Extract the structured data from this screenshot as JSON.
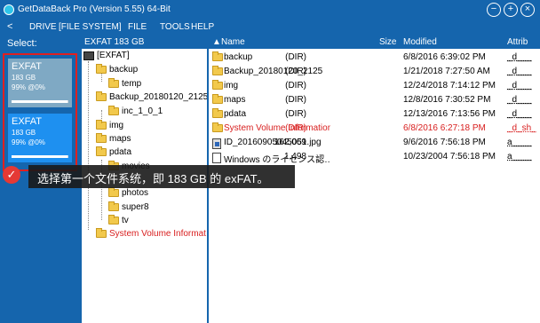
{
  "titlebar": {
    "title": "GetDataBack Pro (Version 5.55) 64-Bit",
    "btn_minimize": "−",
    "btn_maximize": "+",
    "btn_close": "×"
  },
  "menu": {
    "back": "<",
    "items": [
      "DRIVE",
      "[FILE SYSTEM]",
      "FILE",
      "TOOLS",
      "HELP"
    ]
  },
  "sidebar": {
    "select_label": "Select:",
    "drives": [
      {
        "name": "EXFAT",
        "size": "183 GB",
        "pct": "99% @0%",
        "fill": 0.99
      },
      {
        "name": "EXFAT",
        "size": "183 GB",
        "pct": "99% @0%",
        "fill": 0.99
      }
    ]
  },
  "tree": {
    "header": "EXFAT 183 GB",
    "items": [
      {
        "label": "[EXFAT]",
        "icon": "drive-icon",
        "red": false
      },
      {
        "label": "backup",
        "icon": "folder-icon",
        "red": false
      },
      {
        "label": "temp",
        "icon": "folder-icon",
        "red": false
      },
      {
        "label": "Backup_20180120_2125",
        "icon": "folder-icon",
        "red": false
      },
      {
        "label": "inc_1_0_1",
        "icon": "folder-icon",
        "red": false
      },
      {
        "label": "img",
        "icon": "folder-icon",
        "red": false
      },
      {
        "label": "maps",
        "icon": "folder-icon",
        "red": false
      },
      {
        "label": "pdata",
        "icon": "folder-icon",
        "red": false
      },
      {
        "label": "movies",
        "icon": "folder-icon",
        "red": false
      },
      {
        "label": "photos",
        "icon": "folder-icon",
        "red": false
      },
      {
        "label": "super8",
        "icon": "folder-icon",
        "red": false
      },
      {
        "label": "tv",
        "icon": "folder-icon",
        "red": false
      },
      {
        "label": "System Volume Informat",
        "icon": "folder-icon",
        "red": true
      }
    ]
  },
  "list": {
    "columns": {
      "name": "Name",
      "sort_glyph": "▲",
      "size": "Size",
      "modified": "Modified",
      "attrib": "Attrib"
    },
    "rows": [
      {
        "name": "backup",
        "size": "(DIR)",
        "modified": "6/8/2016 6:39:02 PM",
        "attrib": "_d___",
        "icon": "folder-icon",
        "red": false
      },
      {
        "name": "Backup_20180120_2125",
        "size": "(DIR)",
        "modified": "1/21/2018 7:27:50 AM",
        "attrib": "_d___",
        "icon": "folder-icon",
        "red": false
      },
      {
        "name": "img",
        "size": "(DIR)",
        "modified": "12/24/2018 7:14:12 PM",
        "attrib": "_d___",
        "icon": "folder-icon",
        "red": false
      },
      {
        "name": "maps",
        "size": "(DIR)",
        "modified": "12/8/2016 7:30:52 PM",
        "attrib": "_d___",
        "icon": "folder-icon",
        "red": false
      },
      {
        "name": "pdata",
        "size": "(DIR)",
        "modified": "12/13/2016 7:13:56 PM",
        "attrib": "_d___",
        "icon": "folder-icon",
        "red": false
      },
      {
        "name": "System Volume Information",
        "size": "(DIR)",
        "modified": "6/8/2016 6:27:18 PM",
        "attrib": "_d_sh_",
        "icon": "folder-icon",
        "red": true
      },
      {
        "name": "ID_20160905045051.jpg",
        "size": "162,069",
        "modified": "9/6/2016 7:56:18 PM",
        "attrib": "a____",
        "icon": "image-file-icon",
        "red": false
      },
      {
        "name": "Windows のライセンス認…",
        "size": "1,498",
        "modified": "10/23/2004 7:56:18 PM",
        "attrib": "a____",
        "icon": "file-icon",
        "red": false
      }
    ]
  },
  "tooltip": {
    "text": "选择第一个文件系统，即 183 GB 的 exFAT。",
    "check_glyph": "✓"
  },
  "colors": {
    "chrome": "#1565ad",
    "drive_selected": "#1e90f0",
    "drive_idle": "#7fa9c4",
    "highlight_border": "#e02020",
    "system_red": "#d81e1e"
  }
}
